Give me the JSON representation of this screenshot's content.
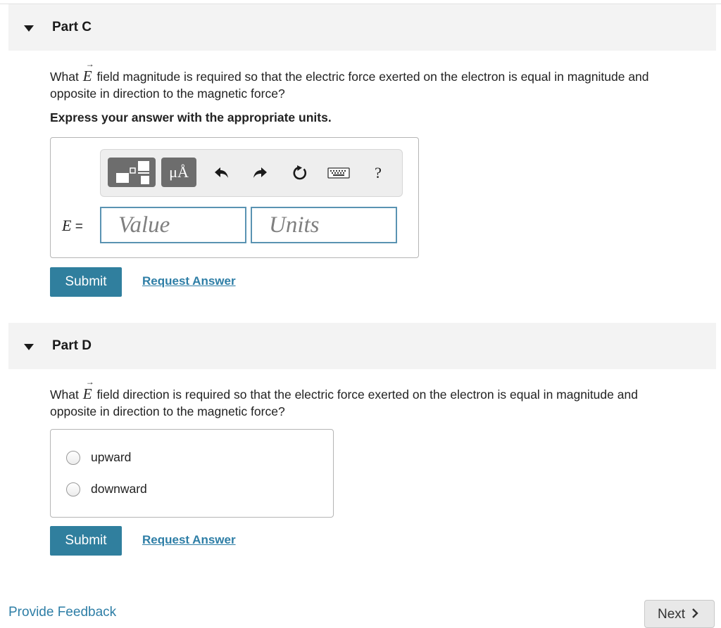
{
  "part_c": {
    "title": "Part C",
    "question_pre": "What",
    "vector_symbol": "E",
    "vector_arrow": "→",
    "question_line1": "field magnitude is required so that the electric force exerted on the electron is equal in magnitude and",
    "question_line2": "opposite in direction to the magnetic force?",
    "instruction": "Express your answer with the appropriate units.",
    "toolbar": {
      "templates_icon": "templates-icon",
      "units_label": "μÅ",
      "undo_icon": "undo-icon",
      "redo_icon": "redo-icon",
      "reset_icon": "reset-icon",
      "keyboard_icon": "keyboard-icon",
      "help_label": "?"
    },
    "answer_label_var": "E",
    "answer_label_eq": "=",
    "value_placeholder": "Value",
    "units_placeholder": "Units",
    "submit_label": "Submit",
    "request_answer_label": "Request Answer"
  },
  "part_d": {
    "title": "Part D",
    "question_pre": "What",
    "vector_symbol": "E",
    "vector_arrow": "→",
    "question_line1": "field direction is required so that the electric force exerted on the electron is equal in magnitude and",
    "question_line2": "opposite in direction to the magnetic force?",
    "options": [
      {
        "label": "upward",
        "selected": false
      },
      {
        "label": "downward",
        "selected": false
      }
    ],
    "submit_label": "Submit",
    "request_answer_label": "Request Answer"
  },
  "footer": {
    "feedback_label": "Provide Feedback",
    "next_label": "Next",
    "next_icon": "chevron-right-icon"
  },
  "colors": {
    "accent": "#307f9e",
    "link": "#2e7ea6",
    "field_border": "#5a93b2",
    "header_bg": "#f3f3f3",
    "toolbar_button": "#6d6d6d"
  }
}
